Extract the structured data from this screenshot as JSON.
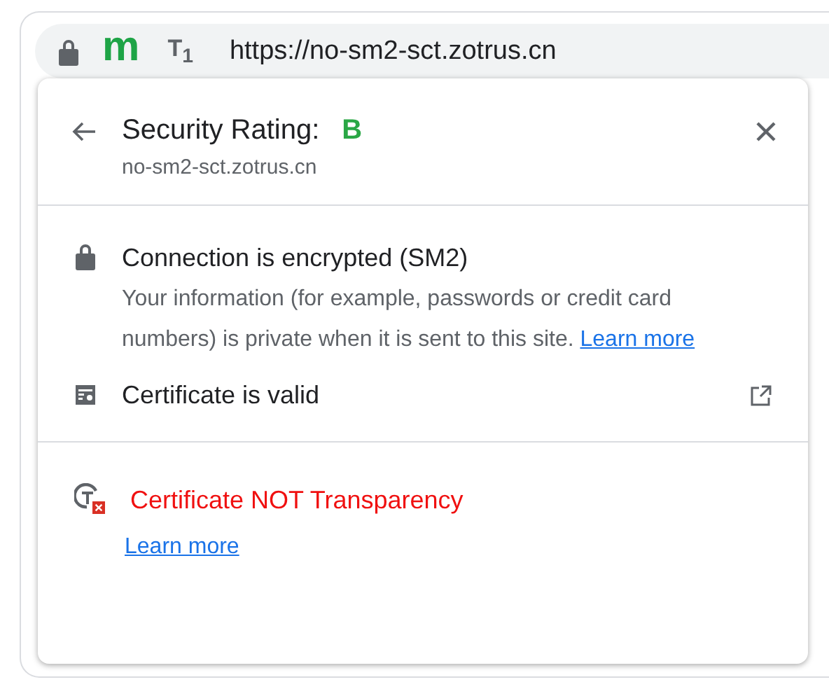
{
  "address_bar": {
    "site_badge": "m",
    "reader_icon_text": "T$_{1}$",
    "url": "https://no-sm2-sct.zotrus.cn"
  },
  "popup": {
    "title": "Security Rating:",
    "rating": "B",
    "domain": "no-sm2-sct.zotrus.cn",
    "sections": [
      {
        "items": [
          {
            "kind": "connection",
            "title": "Connection is encrypted (SM2)",
            "description": "Your information (for example, passwords or credit card numbers) is private when it is sent to this site.",
            "link": "Learn more"
          },
          {
            "kind": "certificate",
            "title": "Certificate is valid",
            "external": true
          }
        ]
      },
      {
        "items": [
          {
            "kind": "transparency",
            "title": "Certificate NOT Transparency",
            "error": true,
            "link": "Learn more"
          }
        ]
      }
    ]
  }
}
